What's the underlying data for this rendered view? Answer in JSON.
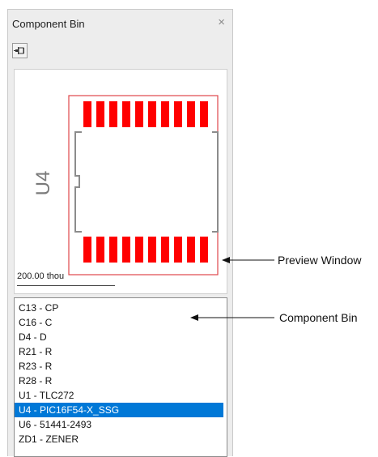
{
  "panel": {
    "title": "Component Bin",
    "close_label": "×",
    "pin_icon": "pin-icon"
  },
  "preview": {
    "designator": "U4",
    "scale_label": "200.00 thou",
    "pad_color": "#ff0000",
    "outline_color": "#e0464b",
    "silkscreen_color": "#8c8c8c",
    "pads_per_row": 10
  },
  "list": {
    "items": [
      "C13 - CP",
      "C16 - C",
      "D4 - D",
      "R21 - R",
      "R23 - R",
      "R28 - R",
      "U1 - TLC272",
      "U4 - PIC16F54-X_SSG",
      "U6 - 51441-2493",
      "ZD1 - ZENER"
    ],
    "selected_index": 7,
    "selection_color": "#0078d7"
  },
  "annotations": {
    "preview_window": "Preview Window",
    "component_bin": "Component Bin"
  }
}
